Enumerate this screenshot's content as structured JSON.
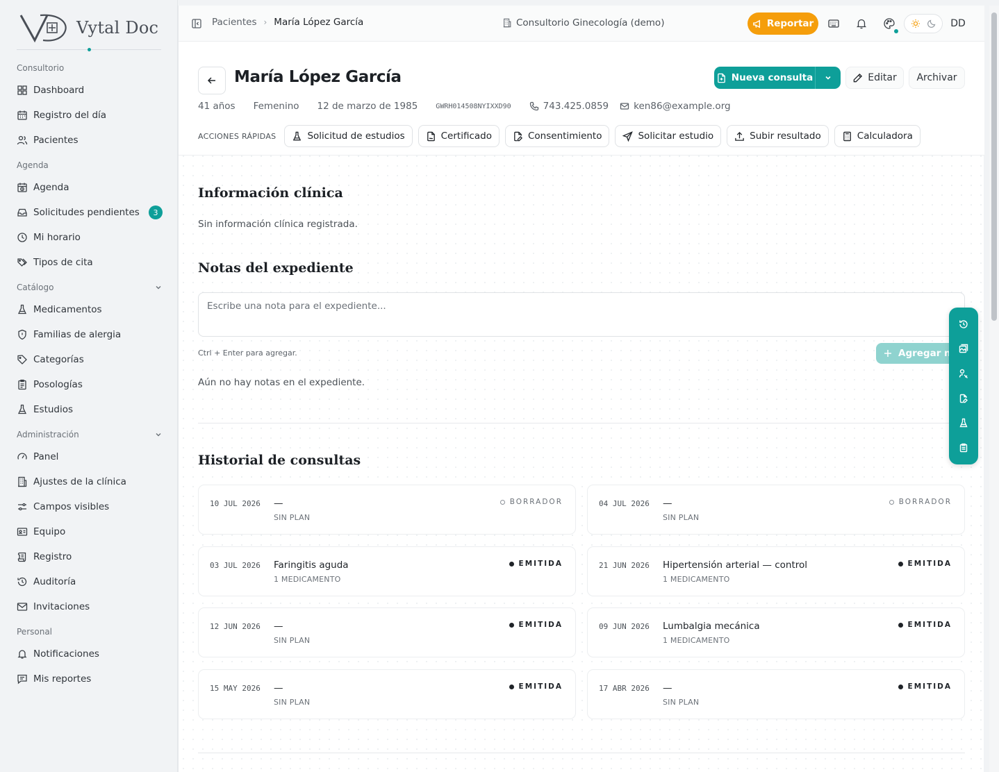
{
  "app": {
    "brand": "Vytal Doc"
  },
  "sidebar": {
    "sections": [
      {
        "label": "Consultorio"
      },
      {
        "label": "Agenda"
      },
      {
        "label": "Catálogo"
      },
      {
        "label": "Administración"
      },
      {
        "label": "Personal"
      }
    ],
    "items": [
      {
        "label": "Dashboard",
        "icon": "grid-icon"
      },
      {
        "label": "Registro del día",
        "icon": "calendar-icon"
      },
      {
        "label": "Pacientes",
        "icon": "users-icon"
      },
      {
        "label": "Agenda",
        "icon": "calendar-clock-icon"
      },
      {
        "label": "Solicitudes pendientes",
        "icon": "inbox-icon",
        "badge": "3"
      },
      {
        "label": "Mi horario",
        "icon": "clock-icon"
      },
      {
        "label": "Tipos de cita",
        "icon": "tags-icon"
      },
      {
        "label": "Medicamentos",
        "icon": "flask-icon"
      },
      {
        "label": "Familias de alergia",
        "icon": "shield-icon"
      },
      {
        "label": "Categorías",
        "icon": "tag-icon"
      },
      {
        "label": "Posologías",
        "icon": "clipboard-icon"
      },
      {
        "label": "Estudios",
        "icon": "flask-icon"
      },
      {
        "label": "Panel",
        "icon": "gauge-icon"
      },
      {
        "label": "Ajustes de la clínica",
        "icon": "building-icon"
      },
      {
        "label": "Campos visibles",
        "icon": "sliders-icon"
      },
      {
        "label": "Equipo",
        "icon": "id-card-icon"
      },
      {
        "label": "Registro",
        "icon": "scroll-icon"
      },
      {
        "label": "Auditoría",
        "icon": "history-icon"
      },
      {
        "label": "Invitaciones",
        "icon": "mail-icon"
      },
      {
        "label": "Notificaciones",
        "icon": "bell-icon"
      },
      {
        "label": "Mis reportes",
        "icon": "message-icon"
      }
    ]
  },
  "topbar": {
    "breadcrumb_parent": "Pacientes",
    "breadcrumb_current": "María López García",
    "clinic": "Consultorio Ginecología (demo)",
    "report_label": "Reportar",
    "avatar_initials": "DD"
  },
  "patient": {
    "name": "María López García",
    "age": "41 años",
    "sex": "Femenino",
    "birthdate": "12 de marzo de 1985",
    "code": "GWRH014508NYIXXD90",
    "phone": "743.425.0859",
    "email": "ken86@example.org"
  },
  "actions": {
    "new_consult": "Nueva consulta",
    "edit": "Editar",
    "archive": "Archivar",
    "quick_label": "ACCIONES RÁPIDAS",
    "quick": [
      {
        "label": "Solicitud de estudios"
      },
      {
        "label": "Certificado"
      },
      {
        "label": "Consentimiento"
      },
      {
        "label": "Solicitar estudio"
      },
      {
        "label": "Subir resultado"
      },
      {
        "label": "Calculadora"
      }
    ]
  },
  "clinical": {
    "title": "Información clínica",
    "empty": "Sin información clínica registrada."
  },
  "notes": {
    "title": "Notas del expediente",
    "placeholder": "Escribe una nota para el expediente...",
    "hint": "Ctrl + Enter para agregar.",
    "add_label": "Agregar nota",
    "empty": "Aún no hay notas en el expediente."
  },
  "history": {
    "title": "Historial de consultas",
    "consults": [
      {
        "date": "10 JUL 2026",
        "diagnosis": "—",
        "plan": "SIN PLAN",
        "status": "BORRADOR"
      },
      {
        "date": "04 JUL 2026",
        "diagnosis": "—",
        "plan": "SIN PLAN",
        "status": "BORRADOR"
      },
      {
        "date": "03 JUL 2026",
        "diagnosis": "Faringitis aguda",
        "plan": "1 MEDICAMENTO",
        "status": "EMITIDA"
      },
      {
        "date": "21 JUN 2026",
        "diagnosis": "Hipertensión arterial — control",
        "plan": "1 MEDICAMENTO",
        "status": "EMITIDA"
      },
      {
        "date": "12 JUN 2026",
        "diagnosis": "—",
        "plan": "SIN PLAN",
        "status": "EMITIDA"
      },
      {
        "date": "09 JUN 2026",
        "diagnosis": "Lumbalgia mecánica",
        "plan": "1 MEDICAMENTO",
        "status": "EMITIDA"
      },
      {
        "date": "15 MAY 2026",
        "diagnosis": "—",
        "plan": "SIN PLAN",
        "status": "EMITIDA"
      },
      {
        "date": "17 ABR 2026",
        "diagnosis": "—",
        "plan": "SIN PLAN",
        "status": "EMITIDA"
      }
    ]
  },
  "colors": {
    "accent": "#0e9f99",
    "report": "#f59e0b"
  }
}
